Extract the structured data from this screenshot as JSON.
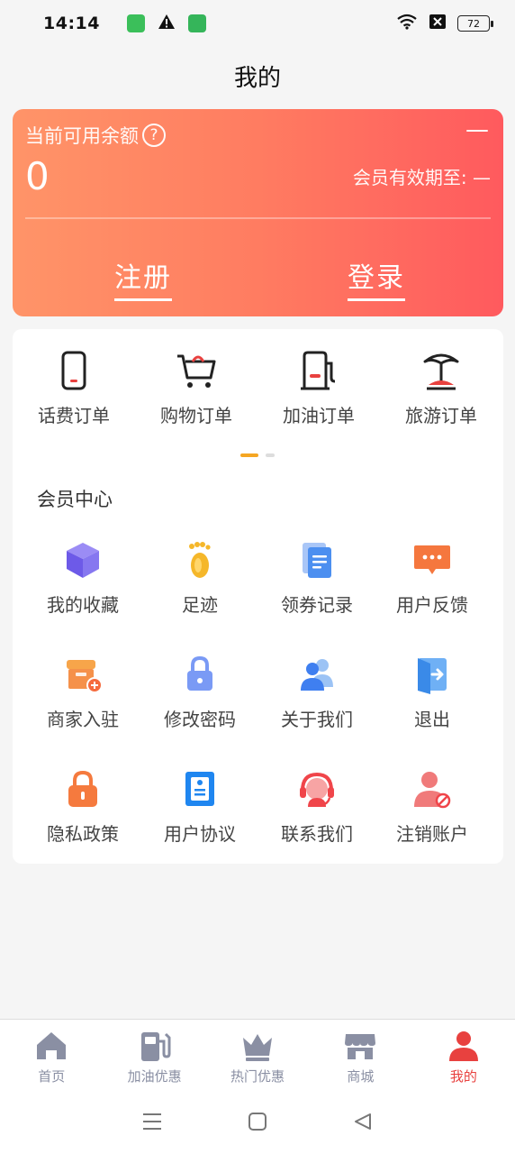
{
  "status_bar": {
    "time": "14:14",
    "battery": "72",
    "icons": [
      "app-notification-icon",
      "warning-icon",
      "shield-icon",
      "wifi-icon",
      "sim-blocked-icon",
      "battery-icon"
    ]
  },
  "page": {
    "title": "我的"
  },
  "balance": {
    "label": "当前可用余额",
    "help_icon": "?",
    "top_right": "—",
    "value": "0",
    "expiry": "会员有效期至: —",
    "register": "注册",
    "login": "登录"
  },
  "orders": [
    {
      "label": "话费订单",
      "icon": "phone-icon"
    },
    {
      "label": "购物订单",
      "icon": "cart-icon"
    },
    {
      "label": "加油订单",
      "icon": "fuel-icon"
    },
    {
      "label": "旅游订单",
      "icon": "palm-tree-icon"
    }
  ],
  "member": {
    "title": "会员中心",
    "items": [
      {
        "label": "我的收藏",
        "icon": "cube-icon"
      },
      {
        "label": "足迹",
        "icon": "footprint-icon"
      },
      {
        "label": "领券记录",
        "icon": "document-icon"
      },
      {
        "label": "用户反馈",
        "icon": "message-icon"
      },
      {
        "label": "商家入驻",
        "icon": "store-add-icon"
      },
      {
        "label": "修改密码",
        "icon": "lock-icon"
      },
      {
        "label": "关于我们",
        "icon": "users-icon"
      },
      {
        "label": "退出",
        "icon": "exit-icon"
      },
      {
        "label": "隐私政策",
        "icon": "padlock-icon"
      },
      {
        "label": "用户协议",
        "icon": "agreement-icon"
      },
      {
        "label": "联系我们",
        "icon": "headset-icon"
      },
      {
        "label": "注销账户",
        "icon": "user-cancel-icon"
      }
    ]
  },
  "tabs": [
    {
      "label": "首页",
      "icon": "home-icon",
      "active": false
    },
    {
      "label": "加油优惠",
      "icon": "fuel-pump-icon",
      "active": false
    },
    {
      "label": "热门优惠",
      "icon": "crown-icon",
      "active": false
    },
    {
      "label": "商城",
      "icon": "shop-icon",
      "active": false
    },
    {
      "label": "我的",
      "icon": "user-icon",
      "active": true
    }
  ],
  "colors": {
    "accent": "#e8413f",
    "card_start": "#ff9468",
    "card_end": "#ff5a5e",
    "pager_active": "#f5a623",
    "tab_inactive": "#8a8fa3"
  }
}
